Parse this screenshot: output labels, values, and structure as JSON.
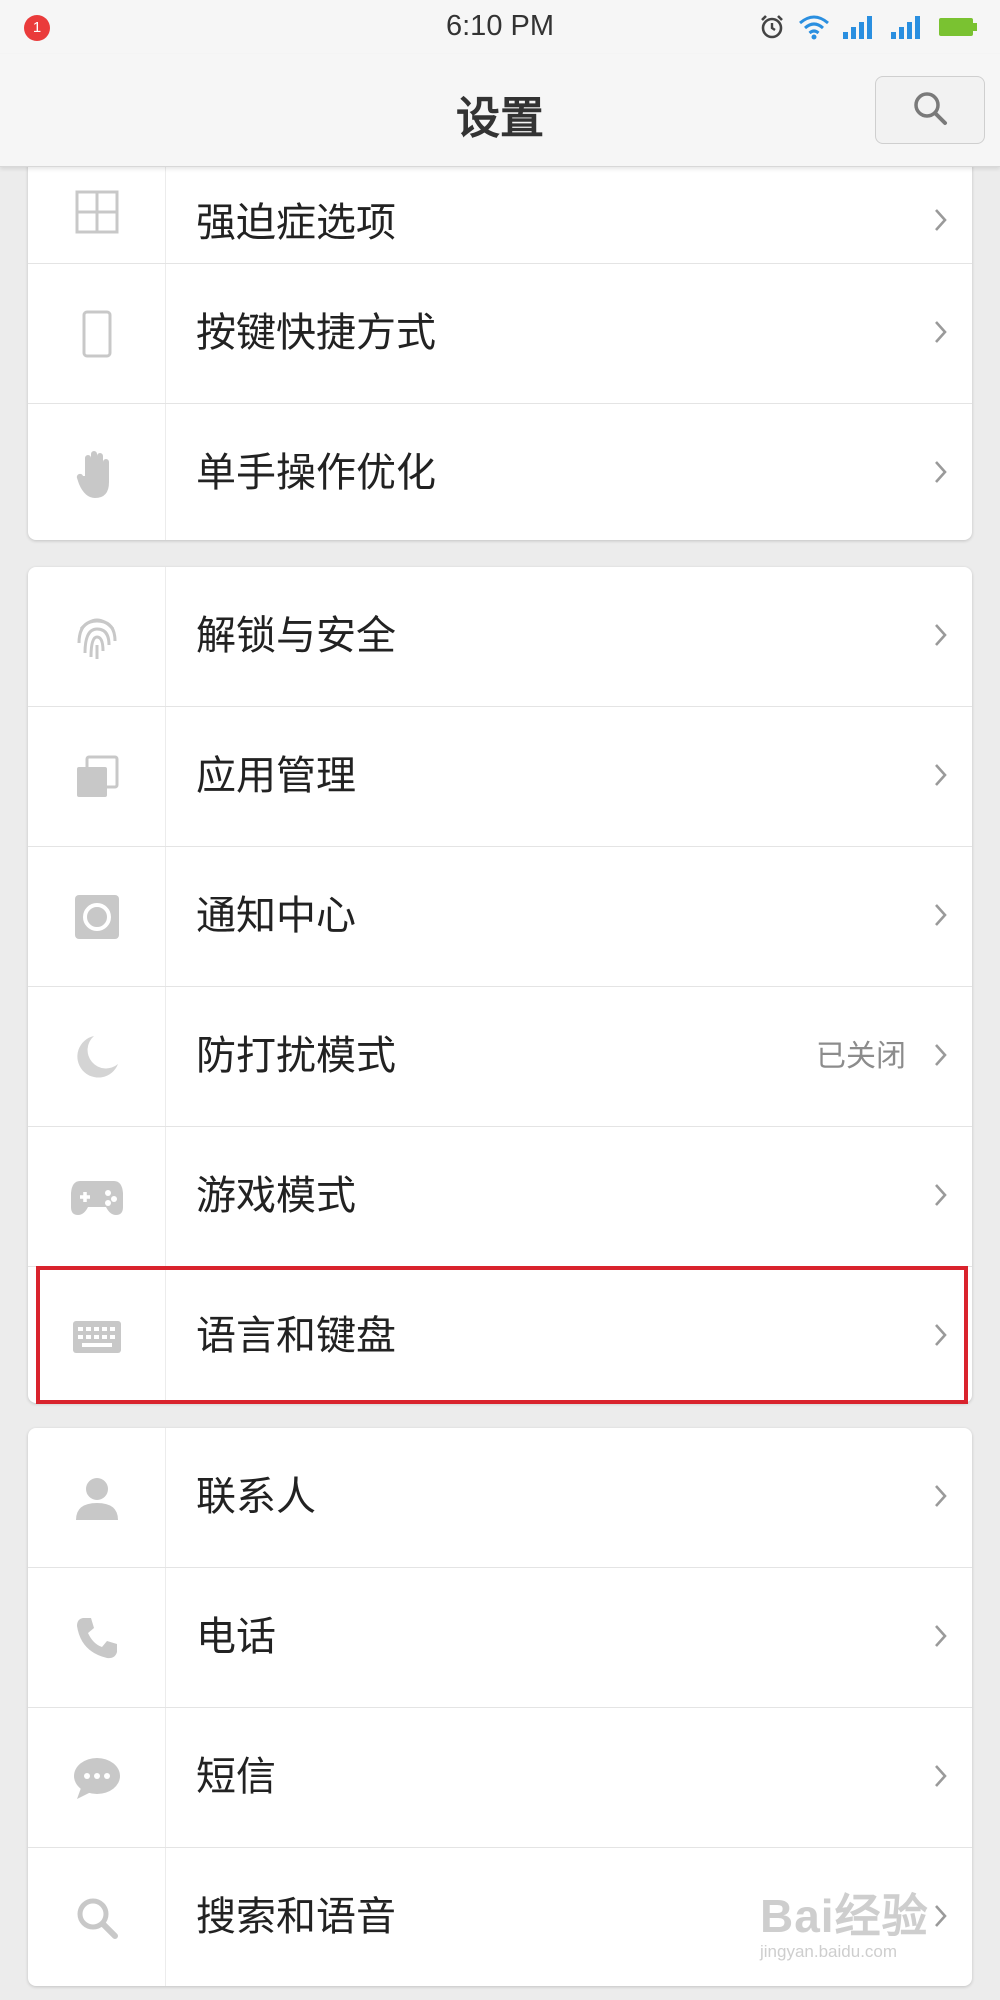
{
  "status_bar": {
    "notification_count": "1",
    "time": "6:10 PM",
    "icons": [
      "alarm-icon",
      "wifi-icon",
      "signal-1-icon",
      "signal-2-icon",
      "battery-icon"
    ],
    "battery_color": "#7ac231"
  },
  "header": {
    "title": "设置",
    "search_icon": "search-icon"
  },
  "cards": [
    {
      "items": [
        {
          "icon": "grid-icon",
          "label": "强迫症选项",
          "value": ""
        },
        {
          "icon": "phone-icon",
          "label": "按键快捷方式",
          "value": ""
        },
        {
          "icon": "hand-icon",
          "label": "单手操作优化",
          "value": ""
        }
      ]
    },
    {
      "items": [
        {
          "icon": "fingerprint-icon",
          "label": "解锁与安全",
          "value": ""
        },
        {
          "icon": "apps-icon",
          "label": "应用管理",
          "value": ""
        },
        {
          "icon": "notification-icon",
          "label": "通知中心",
          "value": ""
        },
        {
          "icon": "moon-icon",
          "label": "防打扰模式",
          "value": "已关闭"
        },
        {
          "icon": "gamepad-icon",
          "label": "游戏模式",
          "value": ""
        },
        {
          "icon": "keyboard-icon",
          "label": "语言和键盘",
          "value": ""
        }
      ]
    },
    {
      "items": [
        {
          "icon": "contact-icon",
          "label": "联系人",
          "value": ""
        },
        {
          "icon": "telephone-icon",
          "label": "电话",
          "value": ""
        },
        {
          "icon": "message-icon",
          "label": "短信",
          "value": ""
        },
        {
          "icon": "search-icon",
          "label": "搜索和语音",
          "value": ""
        }
      ]
    }
  ],
  "highlight_color": "#d9232d",
  "watermark": {
    "main": "Bai经验",
    "sub": "jingyan.baidu.com"
  }
}
